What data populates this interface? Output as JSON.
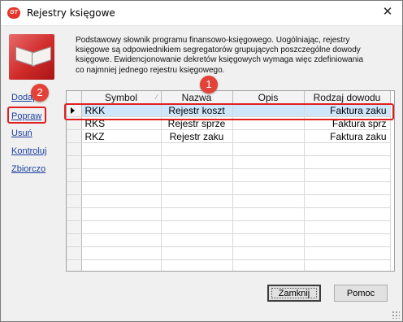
{
  "window": {
    "title": "Rejestry księgowe",
    "app_icon_text": "GT",
    "close_glyph": "✕"
  },
  "sidebar": {
    "icon": "ledger-book-icon",
    "links": [
      {
        "label": "Dodaj"
      },
      {
        "label": "Popraw"
      },
      {
        "label": "Usuń"
      },
      {
        "label": "Kontroluj"
      },
      {
        "label": "Zbiorczo"
      }
    ]
  },
  "description": {
    "lines": [
      "Podstawowy słownik programu finansowo-księgowego. Uogólniając, rejestry",
      "księgowe są odpowiednikiem segregatorów grupujących poszczególne dowody",
      "księgowe. Ewidencjonowanie dekretów księgowych wymaga więc zdefiniowania",
      "co najmniej jednego rejestru księgowego."
    ]
  },
  "table": {
    "columns": [
      "Symbol",
      "Nazwa",
      "Opis",
      "Rodzaj dowodu"
    ],
    "sort_indicator": "⁄",
    "rows": [
      {
        "symbol": "RKK",
        "nazwa": "Rejestr koszt",
        "opis": "",
        "rodzaj": "Faktura zaku",
        "selected": true
      },
      {
        "symbol": "RKS",
        "nazwa": "Rejestr sprze",
        "opis": "",
        "rodzaj": "Faktura sprz",
        "selected": false
      },
      {
        "symbol": "RKZ",
        "nazwa": "Rejestr zaku",
        "opis": "",
        "rodzaj": "Faktura zaku",
        "selected": false
      }
    ],
    "empty_rows": 10
  },
  "buttons": {
    "close_label": "Zamknij",
    "help_label": "Pomoc"
  },
  "annotations": {
    "badge_1": "1",
    "badge_2": "2",
    "color": "#e02020"
  },
  "colors": {
    "selected_row": "#cfe6fb",
    "link": "#1b3fa0",
    "icon_red": "#d02a2a"
  }
}
